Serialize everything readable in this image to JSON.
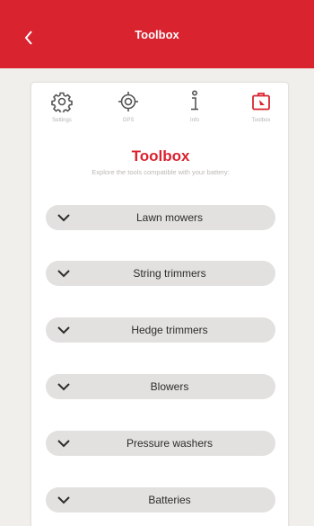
{
  "header": {
    "title": "Toolbox"
  },
  "tabs": [
    {
      "label": "Settings",
      "icon": "gear-icon"
    },
    {
      "label": "GPS",
      "icon": "gps-icon"
    },
    {
      "label": "Info",
      "icon": "info-icon"
    },
    {
      "label": "Toolbox",
      "icon": "toolbox-icon",
      "active": true
    }
  ],
  "main": {
    "title": "Toolbox",
    "subtitle": "Explore the tools compatible with your battery:",
    "items": [
      {
        "label": "Lawn mowers"
      },
      {
        "label": "String trimmers"
      },
      {
        "label": "Hedge trimmers"
      },
      {
        "label": "Blowers"
      },
      {
        "label": "Pressure washers"
      },
      {
        "label": "Batteries"
      }
    ]
  },
  "colors": {
    "accent": "#d9232f",
    "pill": "#e3e1df",
    "background": "#f1efec"
  }
}
